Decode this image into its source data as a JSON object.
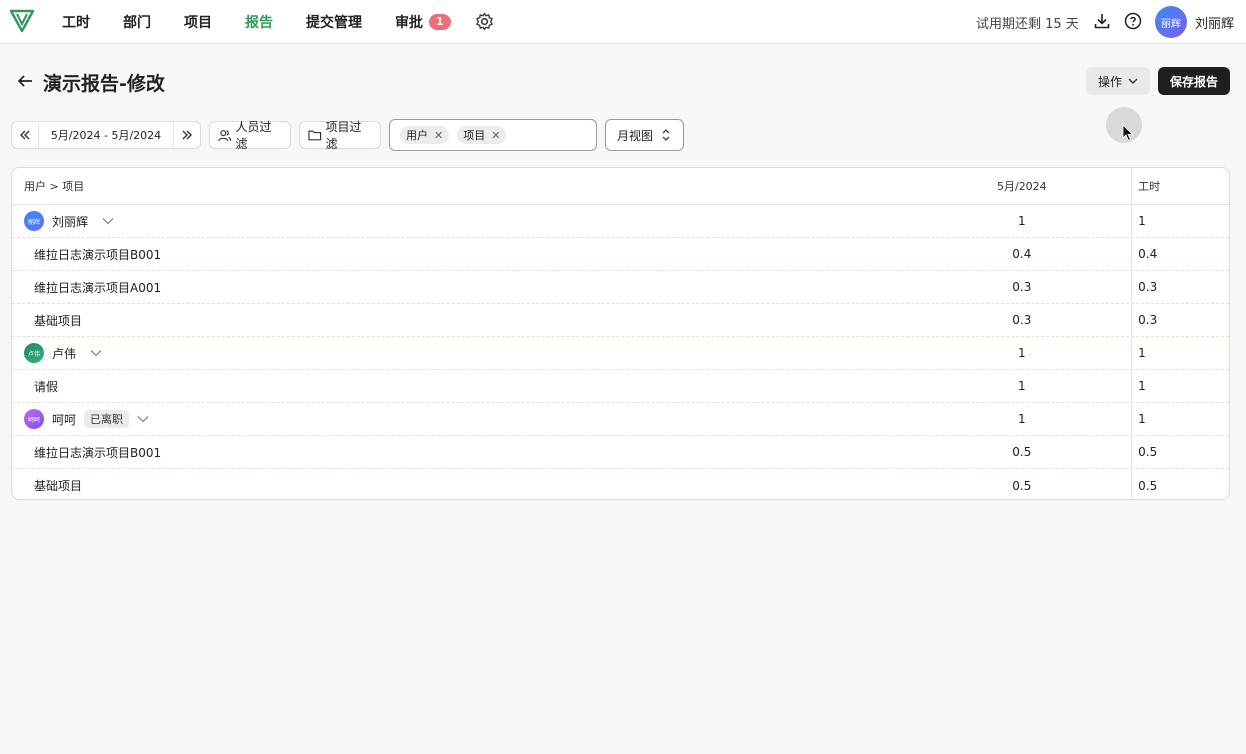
{
  "nav": {
    "items": [
      {
        "label": "工时",
        "active": false
      },
      {
        "label": "部门",
        "active": false
      },
      {
        "label": "项目",
        "active": false
      },
      {
        "label": "报告",
        "active": true
      },
      {
        "label": "提交管理",
        "active": false
      },
      {
        "label": "审批",
        "active": false
      }
    ],
    "approval_badge": "1"
  },
  "header": {
    "trial_text": "试用期还剩 15 天",
    "avatar_text": "丽辉",
    "user_name": "刘丽辉"
  },
  "page": {
    "title": "演示报告-修改",
    "ops_label": "操作",
    "save_label": "保存报告"
  },
  "toolbar": {
    "date_range": "5月/2024 - 5月/2024",
    "people_filter": "人员过滤",
    "project_filter": "项目过滤",
    "group_chips": [
      "用户",
      "项目"
    ],
    "view_mode": "月视图"
  },
  "table": {
    "headers": {
      "dimension": "用户 > 项目",
      "month": "5月/2024",
      "hours": "工时"
    },
    "rows": [
      {
        "type": "user",
        "label": "刘丽辉",
        "avatar": "丽辉",
        "month": "1",
        "hours": "1"
      },
      {
        "type": "project",
        "label": "维拉日志演示项目B001",
        "month": "0.4",
        "hours": "0.4"
      },
      {
        "type": "project",
        "label": "维拉日志演示项目A001",
        "month": "0.3",
        "hours": "0.3"
      },
      {
        "type": "project",
        "label": "基础项目",
        "month": "0.3",
        "hours": "0.3"
      },
      {
        "type": "user",
        "label": "卢伟",
        "avatar": "卢伟",
        "month": "1",
        "hours": "1"
      },
      {
        "type": "project",
        "label": "请假",
        "month": "1",
        "hours": "1"
      },
      {
        "type": "user",
        "label": "呵呵",
        "avatar": "呵呵",
        "tag": "已离职",
        "month": "1",
        "hours": "1"
      },
      {
        "type": "project",
        "label": "维拉日志演示项目B001",
        "month": "0.5",
        "hours": "0.5"
      },
      {
        "type": "project",
        "label": "基础项目",
        "month": "0.5",
        "hours": "0.5"
      }
    ]
  }
}
